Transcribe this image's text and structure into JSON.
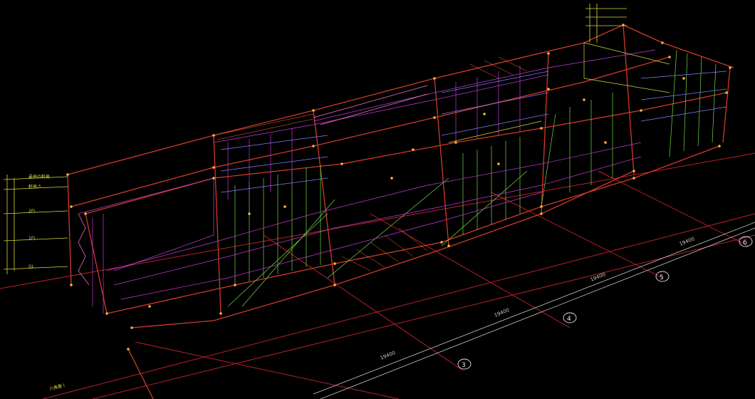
{
  "colors": {
    "background": "#000000",
    "frame": "#d23a2a",
    "panel_magenta": "#c63bd6",
    "panel_green": "#74d845",
    "panel_blue": "#8080ff",
    "panel_pink": "#ff7ad6",
    "node": "#ffb43a",
    "annotation_yellow": "#d8d83a",
    "annotation_grey": "#c8c8c8"
  },
  "grid_axes": [
    {
      "id": "3",
      "label": "3"
    },
    {
      "id": "4",
      "label": "4"
    },
    {
      "id": "5",
      "label": "5"
    },
    {
      "id": "6",
      "label": "6"
    }
  ],
  "dimensions": [
    {
      "id": "d1",
      "text": "19400"
    },
    {
      "id": "d2",
      "text": "19400"
    },
    {
      "id": "d3",
      "text": "19400"
    },
    {
      "id": "d4",
      "text": "19400"
    }
  ],
  "left_annotations": [
    {
      "id": "a1",
      "text": "最高の軒高"
    },
    {
      "id": "a2",
      "text": "軒高さ"
    },
    {
      "id": "a3",
      "text": "2FL"
    },
    {
      "id": "a4",
      "text": "1FL"
    },
    {
      "id": "a5",
      "text": "GL"
    }
  ],
  "bottom_annotation": {
    "text": "六角屋 ("
  },
  "icon": "cad-3d-wireframe-icon"
}
